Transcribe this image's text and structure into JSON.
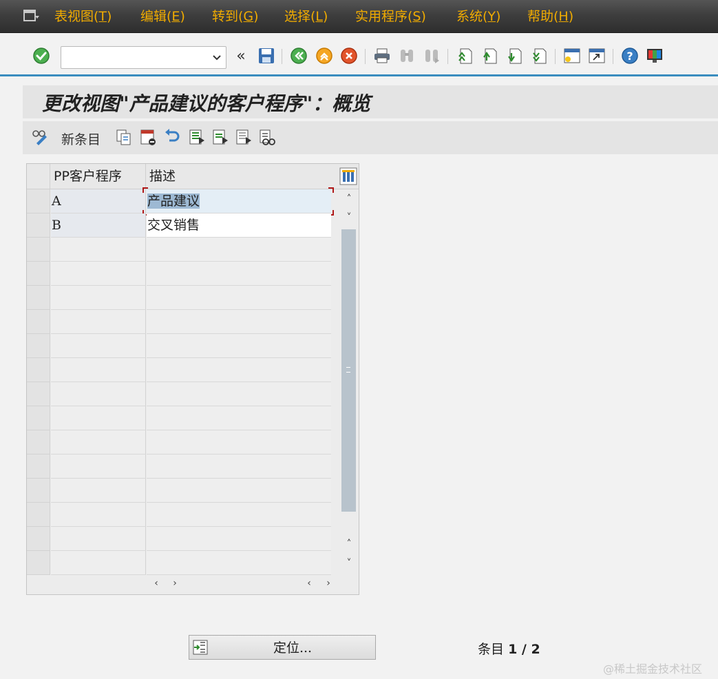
{
  "menubar": {
    "items": [
      {
        "label": "表视图(",
        "mnemonic": "T",
        "close": ")"
      },
      {
        "label": "编辑(",
        "mnemonic": "E",
        "close": ")"
      },
      {
        "label": "转到(",
        "mnemonic": "G",
        "close": ")"
      },
      {
        "label": "选择(",
        "mnemonic": "L",
        "close": ")"
      },
      {
        "label": "实用程序(",
        "mnemonic": "S",
        "close": ")"
      },
      {
        "label": "系统(",
        "mnemonic": "Y",
        "close": ")"
      },
      {
        "label": "帮助(",
        "mnemonic": "H",
        "close": ")"
      }
    ],
    "text_color": "#f0ab00"
  },
  "toolbar": {
    "command_value": "",
    "back_arrow": "«",
    "accent": "#3a8dbf"
  },
  "title": {
    "text": "更改视图\"产品建议的客户程序\"：概览"
  },
  "app_toolbar": {
    "new_entry_label": "新条目"
  },
  "table": {
    "columns": [
      "PP客户程序",
      "描述"
    ],
    "rows": [
      {
        "key": "A",
        "desc": "产品建议"
      },
      {
        "key": "B",
        "desc": "交叉销售"
      }
    ],
    "scroll_up": "˄",
    "scroll_down": "˅",
    "scroll_left": "‹",
    "scroll_right": "›"
  },
  "bottom": {
    "position_button_label": "定位...",
    "entry_prefix": "条目",
    "entry_count": "1 / 2"
  },
  "watermark": "@稀土掘金技术社区"
}
